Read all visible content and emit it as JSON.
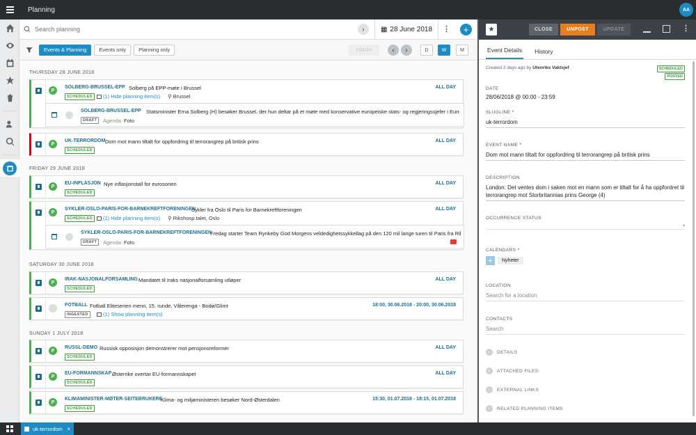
{
  "app": {
    "title": "Planning",
    "user_initials": "AA"
  },
  "search": {
    "placeholder": "Search planning",
    "date": "28 June 2018"
  },
  "filters": {
    "buttons": [
      "Events & Planning",
      "Events only",
      "Planning only"
    ],
    "active": "Events & Planning",
    "today": "TODAY",
    "views": [
      "D",
      "W",
      "M"
    ],
    "active_view": "W"
  },
  "days": [
    {
      "label": "THURSDAY 28 JUNE 2018"
    },
    {
      "label": "FRIDAY 29 JUNE 2018"
    },
    {
      "label": "SATURDAY 30 JUNE 2018"
    },
    {
      "label": "SUNDAY 1 JULY 2018"
    }
  ],
  "events": [
    {
      "slug": "SOLBERG-BRUSSEL-EPP",
      "name": "Solberg på EPP-møte i Brussel",
      "status": "SCHEDULED",
      "time": "ALL DAY",
      "extra": "(1) Hide planning item(s)",
      "location": "Brussel",
      "planning": {
        "slug": "SOLBERG-BRUSSEL-EPP",
        "name": "Statsminister Erna Solberg (H) besøker Brussel, der hun deltar på et møte med konservative europeiske stats- og regjeringssjefer i Euro...",
        "status": "DRAFT",
        "agenda_label": "Agenda:",
        "agenda": "Foto"
      }
    },
    {
      "slug": "UK-TERRORDOM",
      "name": "Dom mot mann tiltalt for oppfordring til terrorangrep på britisk prins",
      "status": "SCHEDULED",
      "time": "ALL DAY"
    },
    {
      "slug": "EU-INFLASJON",
      "name": "Nye inflasjonstall for eurosonen",
      "status": "SCHEDULED",
      "time": "ALL DAY"
    },
    {
      "slug": "SYKLER-OSLO-PARIS-FOR-BARNEKREFTFORENINGEN",
      "name": "Sykler fra Oslo til Paris for Barnekreftforeningen",
      "status": "SCHEDULED",
      "time": "ALL DAY",
      "extra": "(1) Hide planning item(s)",
      "location": "Rikshosp.talet, Oslo",
      "planning": {
        "slug": "SYKLER-OSLO-PARIS-FOR-BARNEKREFTFORENINGEN",
        "name": "Fredag starter Team Rynkeby God Morgens veldedighetssykkellag på den 120 mil lange turen til Paris fra Riks...",
        "status": "DRAFT",
        "agenda_label": "Agenda:",
        "agenda": "Foto"
      }
    },
    {
      "slug": "IRAK-NASJONALFORSAMLING",
      "name": "Mandatet til Iraks nasjonalforsamling utløper",
      "status": "SCHEDULED",
      "time": "ALL DAY"
    },
    {
      "slug": "FOTBALL",
      "name": "Fotball Eliteserien menn, 15. runde, Vålerenga - Bodø/Glimt",
      "status": "INGESTED",
      "time": "18:00, 30.06.2018 - 20:00, 30.06.2018",
      "extra": "(1) Show planning item(s)"
    },
    {
      "slug": "RUSSL-DEMO",
      "name": "Russisk opposisjon demonstrerer mot pensjonsreformer",
      "status": "SCHEDULED",
      "time": "ALL DAY"
    },
    {
      "slug": "EU-FORMANNSKAP",
      "name": "Østerrike overtar EU-formannskapet",
      "status": "SCHEDULED",
      "time": "ALL DAY"
    },
    {
      "slug": "KLIMAMINISTER-MØTER-SEITEBRUKERE",
      "name": "Klima- og miljøministeren besøker Nord-Østerdalen",
      "status": "SCHEDULED",
      "time": "15:30, 01.07.2018 - 18:15, 01.07.2018"
    }
  ],
  "panel": {
    "buttons": {
      "close": "CLOSE",
      "unpost": "UNPOST",
      "update": "UPDATE"
    },
    "tabs": [
      "Event Details",
      "History"
    ],
    "created": "Created 2 days ago by",
    "creator": "Utenriks Vaktsjef",
    "badges": [
      "SCHEDULED",
      "POSTED"
    ],
    "date_label": "DATE",
    "date": "28/06/2018 @ 00:00 - 23:59",
    "slugline_label": "SLUGLINE",
    "slugline": "uk-terrordom",
    "name_label": "EVENT NAME",
    "name": "Dom mot mann tiltalt for oppfordring til terrorangrep på britisk prins",
    "description_label": "DESCRIPTION",
    "description": "London: Det ventes dom i saken mot en mann som er tiltalt for å ha oppfordret til terrorangrep mot Storbritannias prins George (4)",
    "occurrence_label": "OCCURRENCE STATUS",
    "calendars_label": "CALENDARS",
    "calendar": "Nyheter",
    "location_label": "LOCATION",
    "location_placeholder": "Search for a location",
    "contacts_label": "CONTACTS",
    "contacts_placeholder": "Search",
    "sections": [
      "DETAILS",
      "ATTACHED FILES",
      "EXTERNAL LINKS",
      "RELATED PLANNING ITEMS"
    ]
  },
  "bottom_tab": "uk-terrordom"
}
